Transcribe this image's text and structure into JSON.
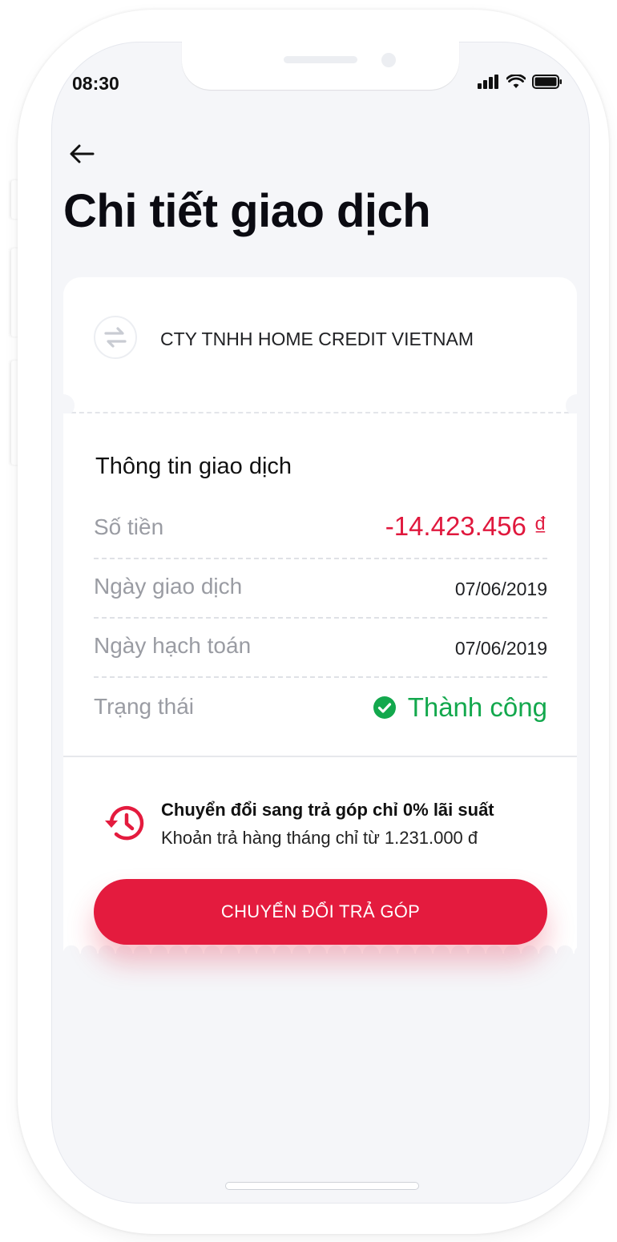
{
  "status_bar": {
    "time": "08:30"
  },
  "header": {
    "title": "Chi tiết giao dịch"
  },
  "merchant": {
    "name": "CTY TNHH HOME CREDIT VIETNAM"
  },
  "transaction": {
    "section_title": "Thông tin giao dịch",
    "rows": [
      {
        "label": "Số tiền",
        "value": "-14.423.456 ₫"
      },
      {
        "label": "Ngày giao dịch",
        "value": "07/06/2019"
      },
      {
        "label": "Ngày hạch toán",
        "value": "07/06/2019"
      },
      {
        "label": "Trạng thái",
        "value": "Thành công"
      }
    ]
  },
  "promo": {
    "title": "Chuyển đổi sang trả góp chỉ 0% lãi suất",
    "subtitle": "Khoản trả hàng tháng chỉ từ 1.231.000 đ"
  },
  "cta": {
    "label": "CHUYỂN ĐỔI TRẢ GÓP"
  },
  "colors": {
    "accent_red": "#e41b3e",
    "amount_red": "#e0183d",
    "success_green": "#13a84d",
    "background": "#f5f6f9"
  },
  "icons": [
    "back-arrow-icon",
    "signal-icon",
    "wifi-icon",
    "battery-icon",
    "transfer-icon",
    "success-check-icon",
    "history-icon"
  ]
}
